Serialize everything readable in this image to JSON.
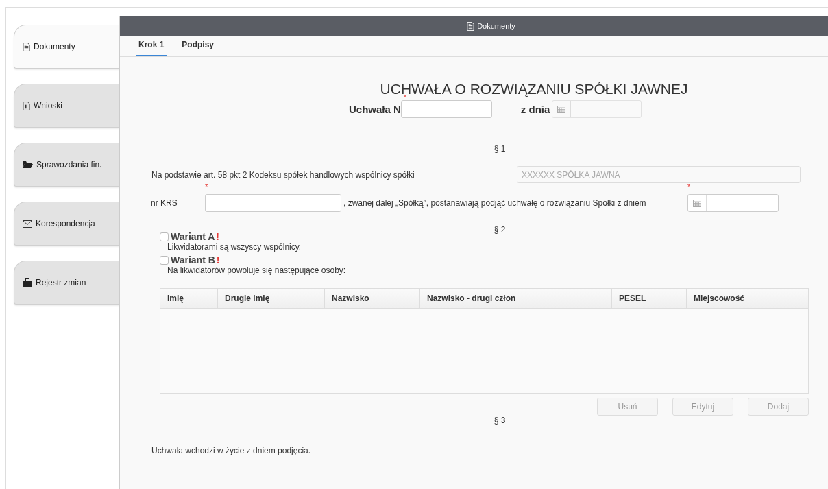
{
  "sidebar": {
    "items": [
      {
        "label": "Dokumenty",
        "selected": true
      },
      {
        "label": "Wnioski",
        "selected": false
      },
      {
        "label": "Sprawozdania fin.",
        "selected": false
      },
      {
        "label": "Korespondencja",
        "selected": false
      },
      {
        "label": "Rejestr zmian",
        "selected": false
      }
    ]
  },
  "window": {
    "title": "Dokumenty"
  },
  "tabs": [
    {
      "label": "Krok 1",
      "selected": true
    },
    {
      "label": "Podpisy",
      "selected": false
    }
  ],
  "form": {
    "title": "UCHWAŁA O ROZWIĄZANIU SPÓŁKI JAWNEJ",
    "number_field": {
      "label": "Uchwała N",
      "required_mark": "*"
    },
    "date_field": {
      "label": "z dnia",
      "disabled": true
    },
    "section_1": "§ 1",
    "basis_text": "Na podstawie art. 58 pkt 2 Kodeksu spółek handlowych wspólnicy spółki",
    "company_field": {
      "value": "XXXXXX SPÓŁKA JAWNA",
      "disabled": true
    },
    "krs_label": "nr KRS",
    "krs_field": {
      "required_mark": "*"
    },
    "krs_text": ", zwanej dalej „Spółką”, postanawiają podjąć uchwałę o rozwiązaniu Spółki z dniem",
    "dissolution_date": {
      "required_mark": "*",
      "disabled": false
    },
    "section_2": "§ 2",
    "variants": [
      {
        "label": "Wariant A",
        "mark": "!",
        "checked": false,
        "description": "Likwidatorami są wszyscy wspólnicy."
      },
      {
        "label": "Wariant B",
        "mark": "!",
        "checked": false,
        "description": "Na likwidatorów powołuje się następujące osoby:"
      }
    ],
    "table": {
      "columns": [
        "Imię",
        "Drugie imię",
        "Nazwisko",
        "Nazwisko - drugi człon",
        "PESEL",
        "Miejscowość"
      ]
    },
    "buttons": [
      {
        "label": "Usuń",
        "disabled": true
      },
      {
        "label": "Edytuj",
        "disabled": true
      },
      {
        "label": "Dodaj",
        "disabled": true
      }
    ],
    "section_3": "§ 3",
    "closing_text": "Uchwała wchodzi w życie z dniem podjęcia."
  }
}
